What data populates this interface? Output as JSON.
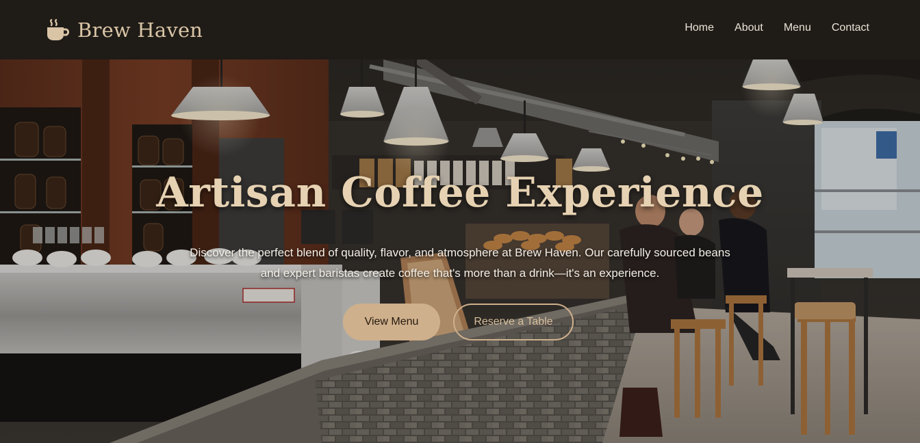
{
  "brand": {
    "name": "Brew Haven",
    "icon": "coffee-cup-icon",
    "accent_color": "#d9c5a6"
  },
  "nav": {
    "items": [
      {
        "label": "Home"
      },
      {
        "label": "About"
      },
      {
        "label": "Menu"
      },
      {
        "label": "Contact"
      }
    ]
  },
  "hero": {
    "title": "Artisan Coffee Experience",
    "subtitle": "Discover the perfect blend of quality, flavor, and atmosphere at Brew Haven. Our carefully sourced beans and expert baristas create coffee that's more than a drink—it's an experience.",
    "primary_button": "View Menu",
    "secondary_button": "Reserve a Table",
    "button_color": "#cfb08c"
  }
}
